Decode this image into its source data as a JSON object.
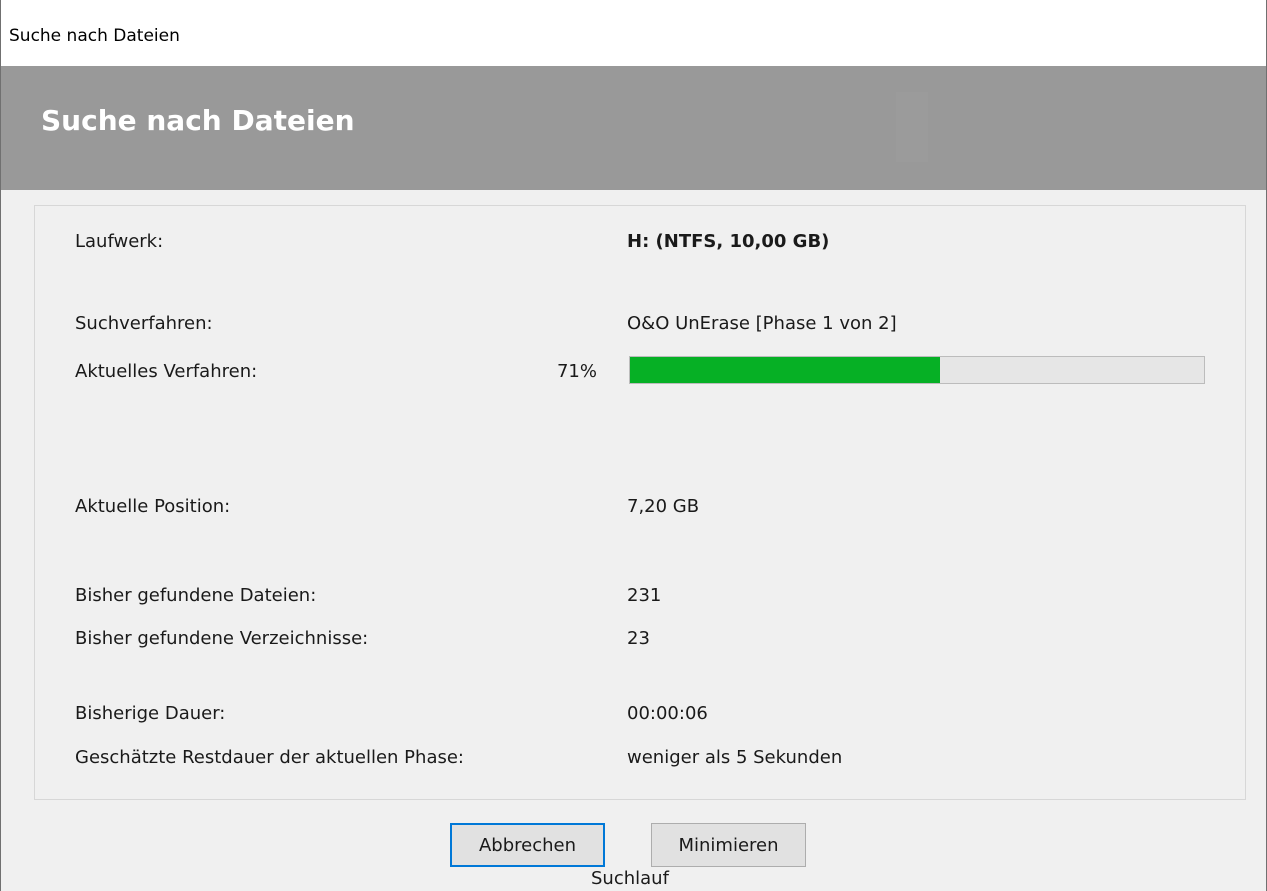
{
  "window": {
    "title": "Suche nach Dateien"
  },
  "banner": {
    "heading": "Suche nach Dateien"
  },
  "info": {
    "drive_label": "Laufwerk:",
    "drive_value": "H: (NTFS, 10,00 GB)",
    "method_label": "Suchverfahren:",
    "method_value": "O&O UnErase [Phase 1 von 2]",
    "current_label": "Aktuelles Verfahren:",
    "current_percent_text": "71%",
    "progress_fraction": 0.54,
    "position_label": "Aktuelle Position:",
    "position_value": "7,20 GB",
    "files_label": "Bisher gefundene Dateien:",
    "files_value": "231",
    "dirs_label": "Bisher gefundene Verzeichnisse:",
    "dirs_value": "23",
    "duration_label": "Bisherige Dauer:",
    "duration_value": "00:00:06",
    "remaining_label": "Geschätzte Restdauer der aktuellen Phase:",
    "remaining_value": "weniger als 5 Sekunden"
  },
  "buttons": {
    "cancel": "Abbrechen",
    "minimize": "Minimieren"
  },
  "footer": {
    "caption": "Suchlauf"
  },
  "colors": {
    "progress": "#06b025",
    "banner": "#999999",
    "focus": "#0078d7"
  }
}
